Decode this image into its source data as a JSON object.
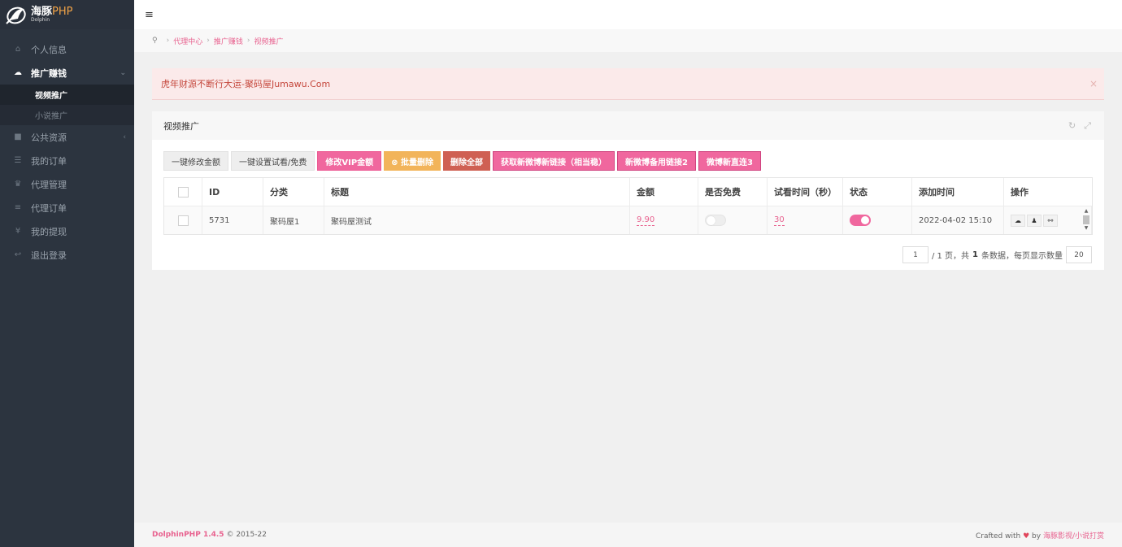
{
  "brand": {
    "name": "海豚",
    "name_php": "PHP",
    "sub": "Dolphin"
  },
  "sidebar": {
    "items": [
      {
        "label": "个人信息",
        "icon": "home-icon"
      },
      {
        "label": "推广赚钱",
        "icon": "cloud-icon",
        "active": true
      },
      {
        "label": "公共资源",
        "icon": "video-icon"
      },
      {
        "label": "我的订单",
        "icon": "list-icon"
      },
      {
        "label": "代理管理",
        "icon": "users-icon"
      },
      {
        "label": "代理订单",
        "icon": "bars-icon"
      },
      {
        "label": "我的提现",
        "icon": "yen-icon"
      },
      {
        "label": "退出登录",
        "icon": "reply-icon"
      }
    ],
    "subitems": [
      {
        "label": "视频推广",
        "active": true
      },
      {
        "label": "小说推广"
      }
    ]
  },
  "breadcrumb": [
    "代理中心",
    "推广赚钱",
    "视频推广"
  ],
  "alert": {
    "text": "虎年财源不断行大运-聚码屋Jumawu.Com",
    "close": "×"
  },
  "panel": {
    "title": "视频推广"
  },
  "toolbar": {
    "b1": "一键修改金额",
    "b2": "一键设置试看/免费",
    "b3": "修改VIP金额",
    "b4": "⊗ 批量删除",
    "b5": "删除全部",
    "b6": "获取新微博新链接（相当稳）",
    "b7": "新微博备用链接2",
    "b8": "微博新直连3"
  },
  "table": {
    "headers": [
      "ID",
      "分类",
      "标题",
      "金额",
      "是否免费",
      "试看时间（秒）",
      "状态",
      "添加时间",
      "操作"
    ],
    "rows": [
      {
        "id": "5731",
        "category": "聚码屋1",
        "title": "聚码屋测试",
        "amount": "9.90",
        "free": false,
        "preview": "30",
        "status": true,
        "added": "2022-04-02 15:10"
      }
    ]
  },
  "pager": {
    "page": "1",
    "total_pages_text": "/ 1 页，共",
    "count": "1",
    "count_suffix": "条数据，每页显示数量",
    "per_page": "20"
  },
  "footer": {
    "version": "DolphinPHP 1.4.5",
    "copyright": "© 2015-22",
    "crafted": "Crafted with",
    "by": "by",
    "author": "海豚影视/小说打赏"
  },
  "colors": {
    "accent": "#e8628f",
    "sidebar": "#2c343f",
    "pink_button": "#f0679e",
    "orange_button": "#f2b45a",
    "red_button": "#cf6053"
  }
}
